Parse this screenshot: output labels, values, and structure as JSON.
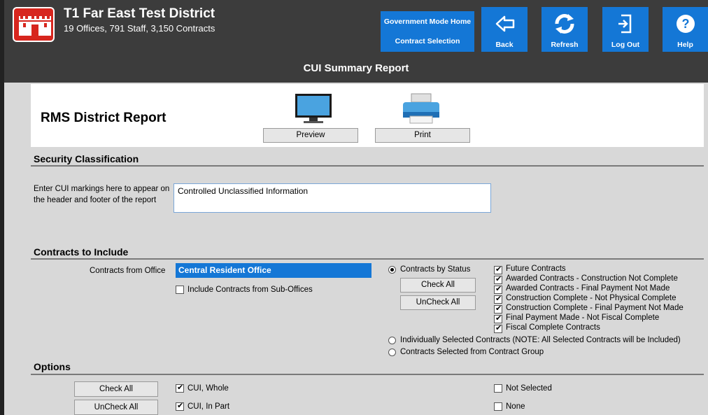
{
  "header": {
    "district_title": "T1 Far East Test District",
    "district_subtitle": "19 Offices, 791 Staff, 3,150 Contracts",
    "nav": {
      "gov_home": "Government Mode Home",
      "contract_selection": "Contract Selection",
      "back": "Back",
      "refresh": "Refresh",
      "logout": "Log Out",
      "help": "Help"
    },
    "accent": "#1477d6"
  },
  "page_title": "CUI Summary Report",
  "report": {
    "name": "RMS District Report",
    "preview_label": "Preview",
    "print_label": "Print"
  },
  "security": {
    "heading": "Security Classification",
    "prompt": "Enter CUI markings here to appear on the header and footer of the report",
    "value": "Controlled Unclassified Information"
  },
  "contracts": {
    "heading": "Contracts to Include",
    "office_label": "Contracts from Office",
    "office_value": "Central Resident Office",
    "include_sub_offices": "Include Contracts from Sub-Offices",
    "by_status_label": "Contracts by Status",
    "check_all": "Check All",
    "uncheck_all": "UnCheck All",
    "statuses": [
      "Future Contracts",
      "Awarded Contracts - Construction Not Complete",
      "Awarded Contracts - Final Payment Not Made",
      "Construction Complete - Not Physical Complete",
      "Construction Complete - Final Payment Not Made",
      "Final Payment Made - Not Fiscal Complete",
      "Fiscal Complete Contracts"
    ],
    "individually_selected": "Individually Selected Contracts (NOTE: All Selected Contracts will be Included)",
    "from_group": "Contracts Selected from Contract Group"
  },
  "options": {
    "heading": "Options",
    "check_all": "Check All",
    "uncheck_all": "UnCheck All",
    "cui_whole": "CUI, Whole",
    "cui_in_part": "CUI, In Part",
    "not_selected": "Not Selected",
    "none": "None"
  }
}
